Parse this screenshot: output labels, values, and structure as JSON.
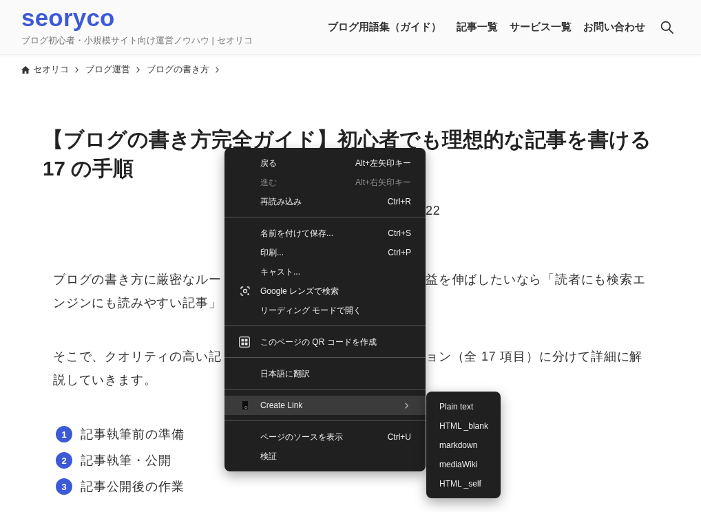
{
  "header": {
    "logo": "seoryco",
    "tagline": "ブログ初心者・小規模サイト向け運営ノウハウ | セオリコ",
    "nav": [
      "ブログ用語集（ガイド）",
      "記事一覧",
      "サービス一覧",
      "お問い合わせ"
    ]
  },
  "breadcrumb": [
    "セオリコ",
    "ブログ運営",
    "ブログの書き方"
  ],
  "article": {
    "title_lines": [
      "【ブログの書き方完全ガイド】初心者でも理想的な記事を書ける",
      "17 の手順"
    ],
    "date_fragment": "22",
    "paragraphs": [
      [
        [
          "ブログの書き方に厳密なルー",
          "益を伸ばしたいなら「読者にも検索エ"
        ],
        [
          "ンジンにも読みやすい記事」"
        ]
      ],
      [
        [
          "そこで、クオリティの高い記",
          "ョン（全 17 項目）に分けて詳細に解"
        ],
        [
          "説していきます。"
        ]
      ]
    ],
    "steps": [
      {
        "number": "1",
        "label": "記事執筆前の準備"
      },
      {
        "number": "2",
        "label": "記事執筆・公開"
      },
      {
        "number": "3",
        "label": "記事公開後の作業"
      }
    ]
  },
  "context_menu": {
    "sections": [
      [
        {
          "kind": "plain",
          "label": "戻る",
          "shortcut": "Alt+左矢印キー",
          "disabled": false,
          "selected": false
        },
        {
          "kind": "plain",
          "label": "進む",
          "shortcut": "Alt+右矢印キー",
          "disabled": true,
          "selected": false
        },
        {
          "kind": "plain",
          "label": "再読み込み",
          "shortcut": "Ctrl+R",
          "disabled": false,
          "selected": false
        }
      ],
      [
        {
          "kind": "plain",
          "label": "名前を付けて保存...",
          "shortcut": "Ctrl+S",
          "disabled": false,
          "selected": false
        },
        {
          "kind": "plain",
          "label": "印刷...",
          "shortcut": "Ctrl+P",
          "disabled": false,
          "selected": false
        },
        {
          "kind": "plain",
          "label": "キャスト...",
          "disabled": false,
          "selected": false
        },
        {
          "kind": "lens",
          "label": "Google レンズで検索",
          "disabled": false,
          "selected": false
        },
        {
          "kind": "plain",
          "label": "リーディング モードで開く",
          "disabled": false,
          "selected": false
        }
      ],
      [
        {
          "kind": "qr",
          "label": "このページの QR コードを作成",
          "disabled": false,
          "selected": false
        }
      ],
      [
        {
          "kind": "plain",
          "label": "日本語に翻訳",
          "disabled": false,
          "selected": false
        }
      ],
      [
        {
          "kind": "submenu",
          "label": "Create Link",
          "disabled": false,
          "selected": true
        }
      ],
      [
        {
          "kind": "plain",
          "label": "ページのソースを表示",
          "shortcut": "Ctrl+U",
          "disabled": false,
          "selected": false
        },
        {
          "kind": "plain",
          "label": "検証",
          "disabled": false,
          "selected": false
        }
      ]
    ]
  },
  "create_link_submenu": {
    "items": [
      "Plain text",
      "HTML _blank",
      "markdown",
      "mediaWiki",
      "HTML _self"
    ]
  }
}
